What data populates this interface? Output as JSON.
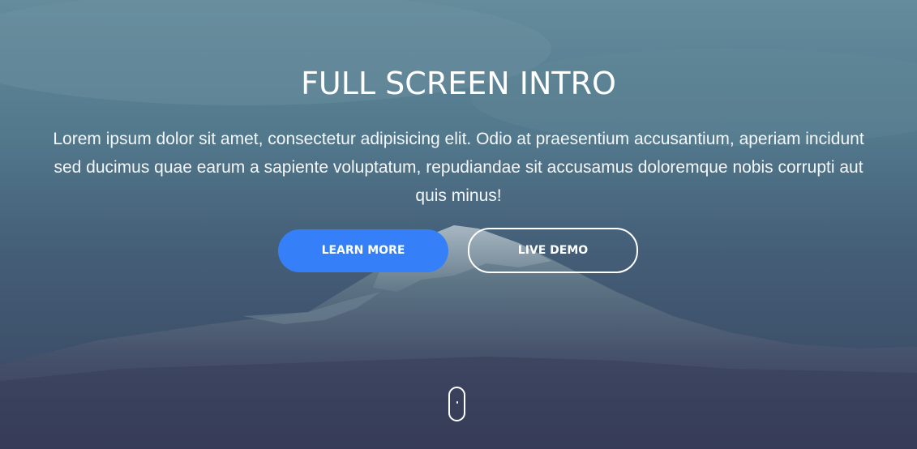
{
  "hero": {
    "title": "FULL SCREEN INTRO",
    "lead": "Lorem ipsum dolor sit amet, consectetur adipisicing elit. Odio at praesentium accusantium, aperiam incidunt sed ducimus quae earum a sapiente voluptatum, repudiandae sit accusamus doloremque nobis corrupti aut quis minus!",
    "primary_button": "LEARN MORE",
    "secondary_button": "LIVE DEMO"
  },
  "scroll_indicator": {
    "icon": "mouse-scroll-icon"
  },
  "colors": {
    "primary": "#3580f8",
    "text": "#ffffff"
  }
}
